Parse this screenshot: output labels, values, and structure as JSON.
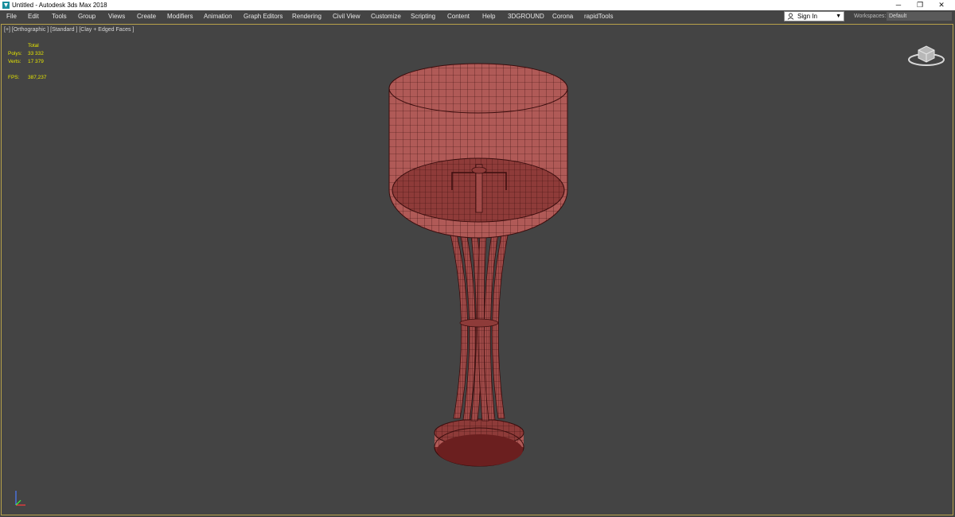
{
  "window": {
    "title": "Untitled - Autodesk 3ds Max 2018",
    "minimize": "─",
    "maximize": "❐",
    "close": "✕"
  },
  "menu": {
    "items": [
      "File",
      "Edit",
      "Tools",
      "Group",
      "Views",
      "Create",
      "Modifiers",
      "Animation",
      "Graph Editors",
      "Rendering",
      "Civil View",
      "Customize",
      "Scripting",
      "Content",
      "Help",
      "3DGROUND",
      "Corona",
      "rapidTools"
    ],
    "signin_label": "Sign In",
    "workspaces_label": "Workspaces:",
    "workspaces_value": "Default"
  },
  "viewport": {
    "label": "[+] [Orthographic ] [Standard ] [Clay + Edged Faces ]",
    "stats": {
      "header": "Total",
      "polys_label": "Polys:",
      "polys_value": "33 332",
      "verts_label": "Verts:",
      "verts_value": "17 379",
      "fps_label": "FPS:",
      "fps_value": "387,237"
    }
  },
  "colors": {
    "model_fill": "#b05a57",
    "model_dark": "#7a2626",
    "wire": "#3a0d0d",
    "stats_text": "#e6e600",
    "viewport_border": "#b8a24a"
  },
  "icons": {
    "app": "3ds-max-icon",
    "user": "user-icon",
    "viewcube": "viewcube-icon",
    "axis": "axis-tripod-icon"
  }
}
